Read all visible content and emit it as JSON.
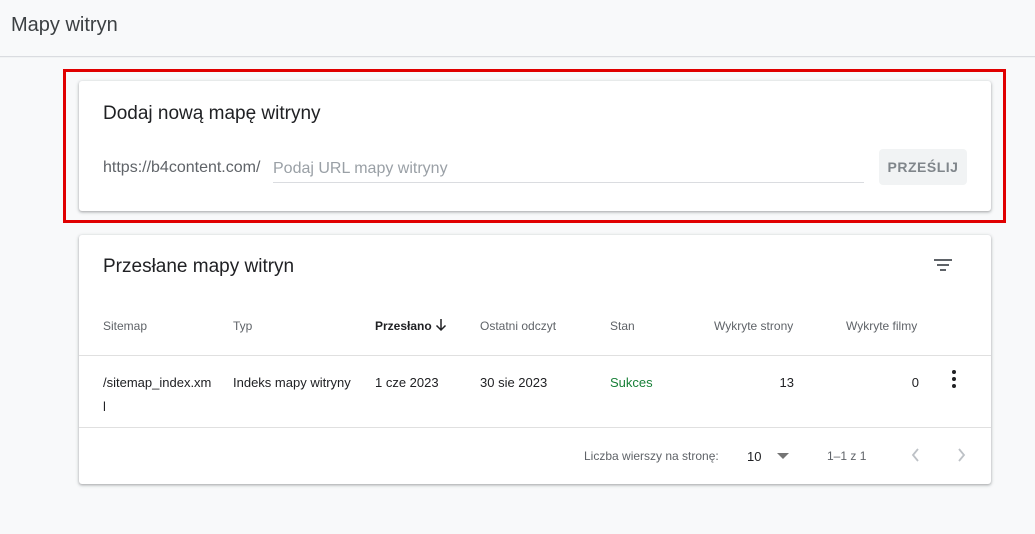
{
  "page": {
    "title": "Mapy witryn"
  },
  "add_sitemap": {
    "title": "Dodaj nową mapę witryny",
    "url_prefix": "https://b4content.com/",
    "input_value": "",
    "input_placeholder": "Podaj URL mapy witryny",
    "submit_label": "PRZEŚLIJ"
  },
  "submitted": {
    "title": "Przesłane mapy witryn",
    "filter_icon": "filter-icon",
    "columns": [
      "Sitemap",
      "Typ",
      "Przesłano",
      "Ostatni odczyt",
      "Stan",
      "Wykryte strony",
      "Wykryte filmy"
    ],
    "sorted_column": "Przesłano",
    "rows": [
      {
        "sitemap": "/sitemap_index.xml",
        "type": "Indeks mapy witryny",
        "submitted": "1 cze 2023",
        "last_read": "30 sie 2023",
        "status": "Sukces",
        "pages": "13",
        "videos": "0"
      }
    ],
    "pagination": {
      "rows_per_page_label": "Liczba wierszy na stronę:",
      "rows_per_page": "10",
      "range": "1–1 z 1"
    }
  },
  "colors": {
    "highlight": "#e00000",
    "success": "#188038"
  }
}
